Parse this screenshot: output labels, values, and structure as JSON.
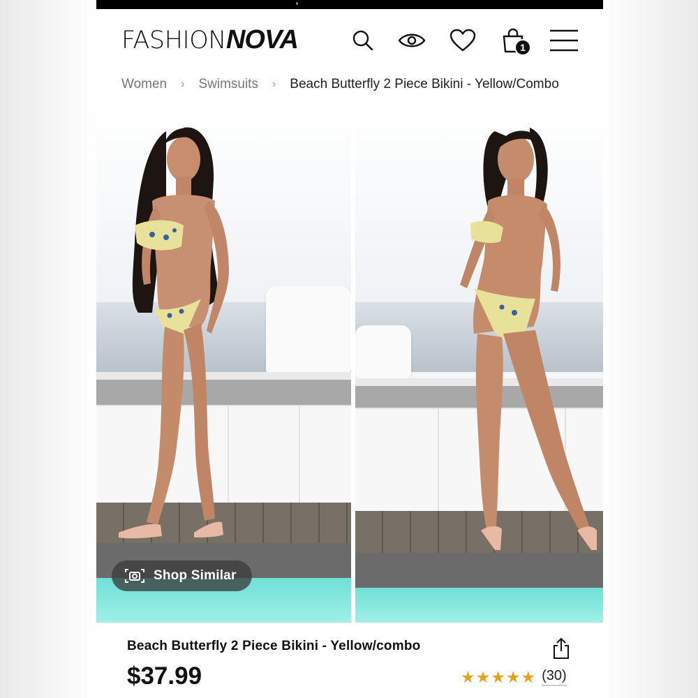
{
  "header": {
    "logo_thin": "FASHION",
    "logo_bold": "NOVA",
    "cart_count": "1",
    "icons": [
      "search-icon",
      "eye-icon",
      "heart-icon",
      "shopping-bag-icon",
      "menu-icon"
    ]
  },
  "breadcrumb": {
    "items": [
      "Women",
      "Swimsuits",
      "Beach Butterfly 2 Piece Bikini - Yellow/Combo"
    ]
  },
  "gallery": {
    "shop_similar_label": "Shop Similar",
    "image_count": 2
  },
  "product": {
    "title": "Beach Butterfly 2 Piece Bikini - Yellow/combo",
    "price": "$37.99",
    "rating_stars": 5,
    "review_count": "(30)"
  },
  "colors": {
    "star": "#e1a320",
    "text": "#111111",
    "badge": "#111111"
  }
}
